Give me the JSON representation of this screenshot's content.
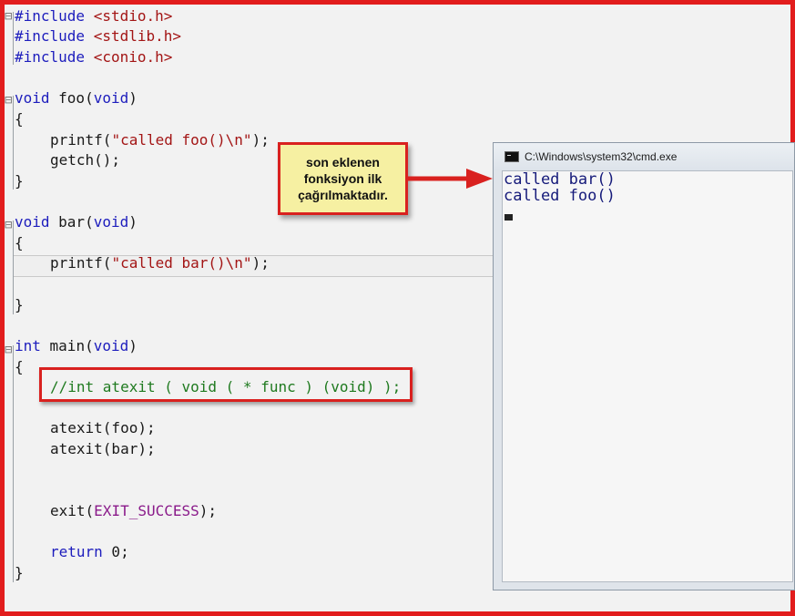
{
  "code": {
    "lines": {
      "inc1_kw": "#include",
      "inc1_hdr": "<stdio.h>",
      "inc2_kw": "#include",
      "inc2_hdr": "<stdlib.h>",
      "inc3_kw": "#include",
      "inc3_hdr": "<conio.h>",
      "foo_sig_kw": "void",
      "foo_sig_name": " foo(",
      "foo_sig_arg": "void",
      "foo_sig_close": ")",
      "brace_open_1": "{",
      "foo_printf": "printf(",
      "foo_printf_str": "\"called foo()\\n\"",
      "foo_printf_end": ");",
      "getch": "getch();",
      "brace_close_1": "}",
      "bar_sig_kw": "void",
      "bar_sig_name": " bar(",
      "bar_sig_arg": "void",
      "bar_sig_close": ")",
      "brace_open_2": "{",
      "bar_printf": "printf(",
      "bar_printf_str": "\"called bar()\\n\"",
      "bar_printf_end": ");",
      "brace_close_2": "}",
      "main_kw": "int",
      "main_name": " main(",
      "main_arg": "void",
      "main_close": ")",
      "brace_open_3": "{",
      "comment": "//int atexit ( void ( * func ) (void) );",
      "atexit_foo": "atexit(foo);",
      "atexit_bar": "atexit(bar);",
      "exit_open": "exit(",
      "exit_macro": "EXIT_SUCCESS",
      "exit_close": ");",
      "return_kw": "return",
      "return_val": " 0;",
      "brace_close_3": "}"
    },
    "fold_markers": [
      "⊟",
      "⊟",
      "⊟",
      "⊟"
    ]
  },
  "callout": {
    "text_line1": "son eklenen",
    "text_line2": "fonksiyon ilk",
    "text_line3": "çağrılmaktadır."
  },
  "console": {
    "title": "C:\\Windows\\system32\\cmd.exe",
    "output": [
      "called bar()",
      "called foo()"
    ]
  },
  "colors": {
    "annotation_red": "#e21d1d",
    "callout_yellow": "#f6f0a2",
    "keyword_blue": "#1d1dbd",
    "string_red": "#a31515",
    "comment_green": "#1f7a1f"
  }
}
